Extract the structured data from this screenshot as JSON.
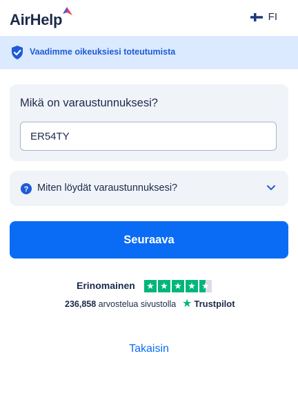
{
  "header": {
    "logo_text": "AirHelp",
    "language": "FI"
  },
  "banner": {
    "text": "Vaadimme oikeuksiesi toteutumista"
  },
  "booking": {
    "question": "Mikä on varaustunnuksesi?",
    "input_value": "ER54TY"
  },
  "faq": {
    "question": "Miten löydät varaustunnuksesi?"
  },
  "actions": {
    "next_label": "Seuraava",
    "back_label": "Takaisin"
  },
  "trustpilot": {
    "rating_label": "Erinomainen",
    "stars": 4.5,
    "review_count": "236,858",
    "review_text": "arvostelua sivustolla",
    "brand": "Trustpilot"
  },
  "colors": {
    "primary": "#0a6cf5",
    "banner_bg": "#dbeafe",
    "card_bg": "#f0f3f8",
    "text": "#1b2a4a",
    "trustpilot_green": "#00b67a"
  }
}
